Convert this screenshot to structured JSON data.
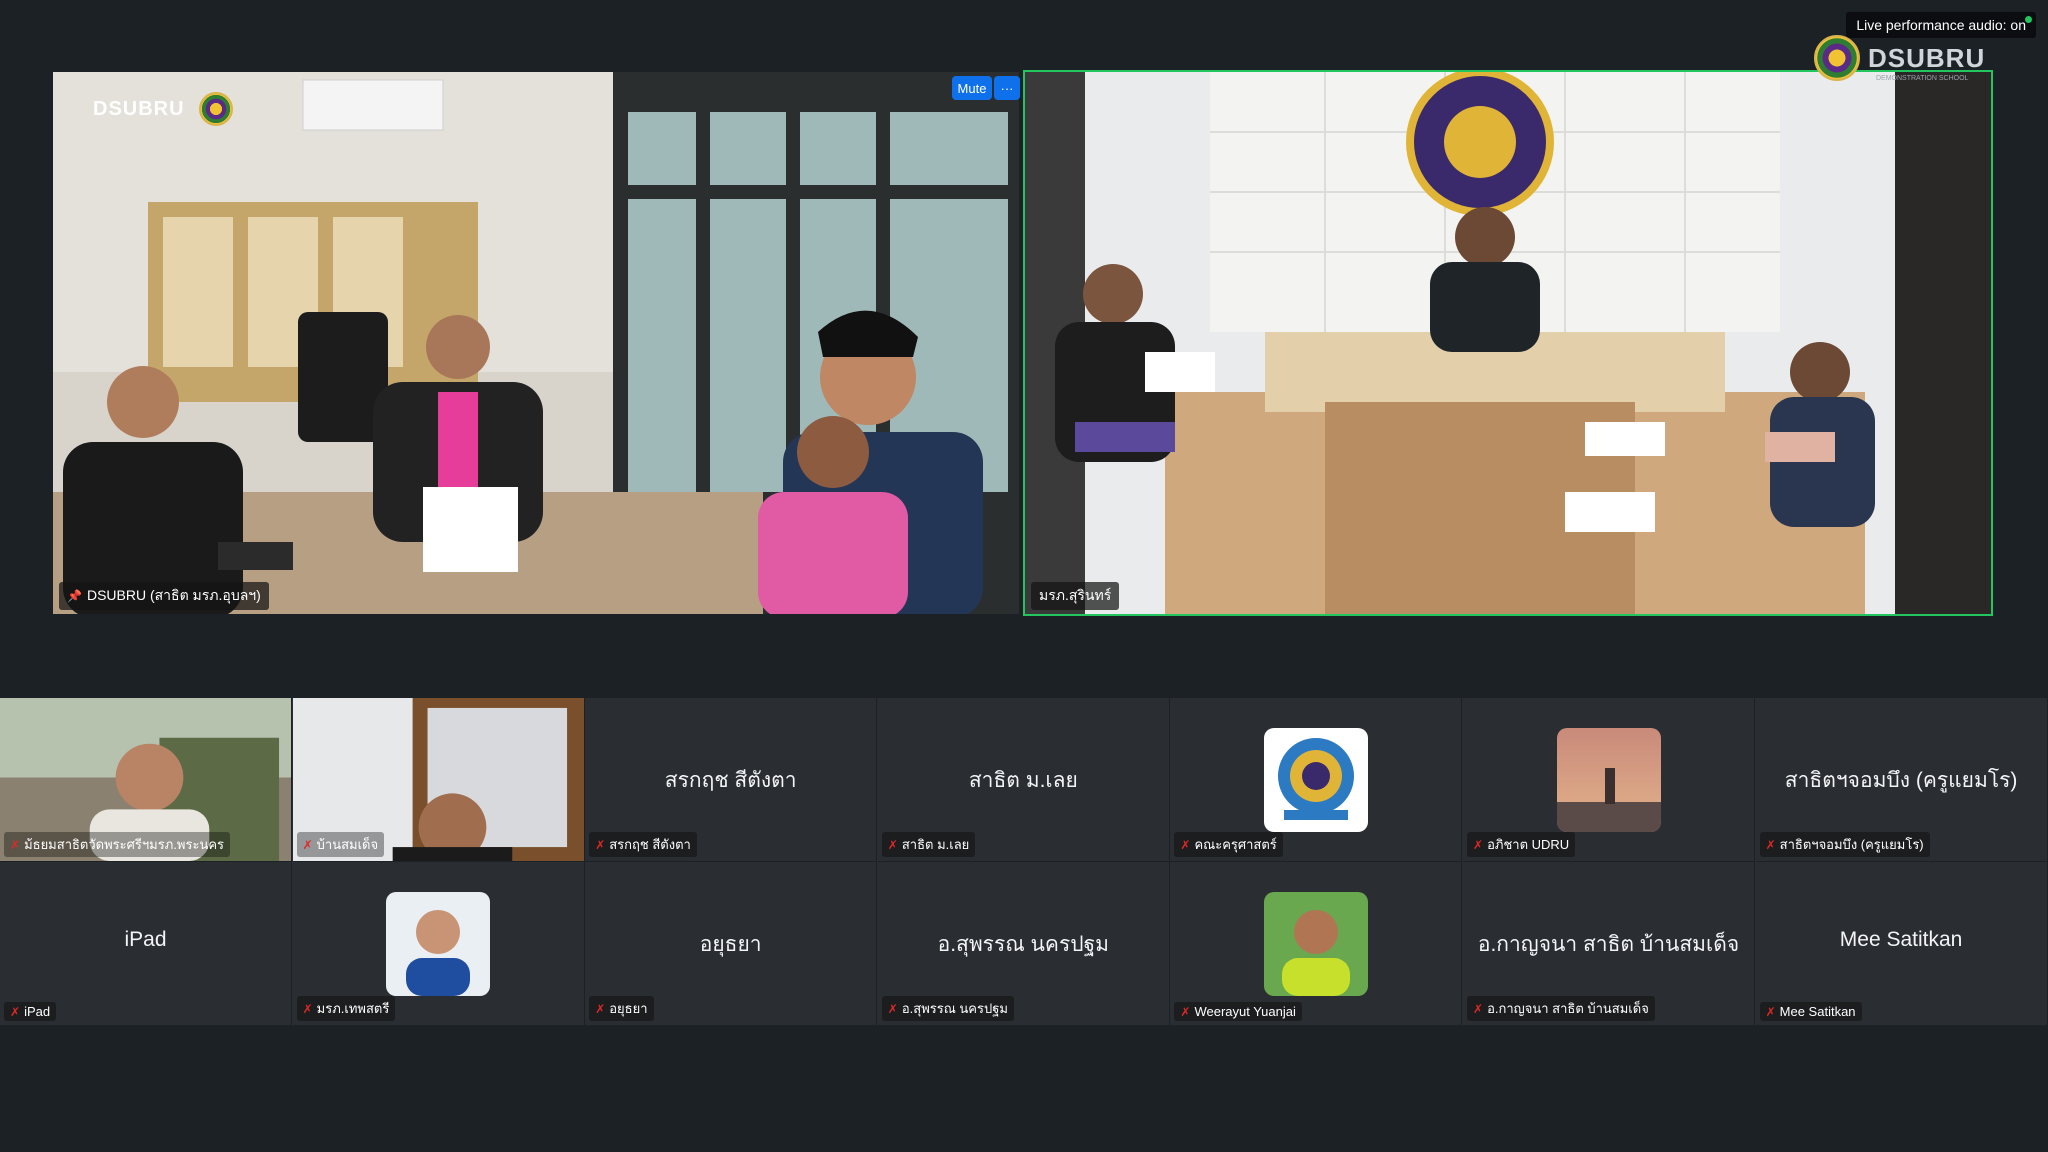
{
  "top_indicator": {
    "text": "Live performance audio: on"
  },
  "brand": {
    "name": "DSUBRU",
    "sub": "DEMONSTRATION SCHOOL"
  },
  "speaker_left": {
    "name": "DSUBRU (สาธิต มรภ.อุบลฯ)",
    "mute_label": "Mute",
    "more_label": "···"
  },
  "speaker_right": {
    "name": "มรภ.สุรินทร์"
  },
  "gallery": {
    "row1": [
      {
        "label": "ม้ธยมสาธิตวัดพระศรีฯมรภ.พระนคร",
        "center": "",
        "kind": "video-man"
      },
      {
        "label": "บ้านสมเด็จ",
        "center": "",
        "kind": "video-room"
      },
      {
        "label": "สรกฤช สีตังตา",
        "center": "สรกฤช สีตังตา",
        "kind": "text"
      },
      {
        "label": "สาธิต ม.เลย",
        "center": "สาธิต ม.เลย",
        "kind": "text"
      },
      {
        "label": "คณะครุศาสตร์",
        "center": "",
        "kind": "avatar-seal"
      },
      {
        "label": "อภิชาต UDRU",
        "center": "",
        "kind": "avatar-sunset"
      },
      {
        "label": "สาธิตฯจอมบึง (ครูแยมโร)",
        "center": "สาธิตฯจอมบึง (ครูแยมโร)",
        "kind": "text"
      }
    ],
    "row2": [
      {
        "label": "iPad",
        "center": "iPad",
        "kind": "text"
      },
      {
        "label": "มรภ.เทพสตรี",
        "center": "",
        "kind": "avatar-person"
      },
      {
        "label": "อยุธยา",
        "center": "อยุธยา",
        "kind": "text"
      },
      {
        "label": "อ.สุพรรณ นครปฐม",
        "center": "อ.สุพรรณ นครปฐม",
        "kind": "text"
      },
      {
        "label": "Weerayut Yuanjai",
        "center": "",
        "kind": "avatar-green"
      },
      {
        "label": "อ.กาญจนา สาธิต บ้านสมเด็จ",
        "center": "อ.กาญจนา สาธิต บ้านสมเด็จ",
        "kind": "text"
      },
      {
        "label": "Mee Satitkan",
        "center": "Mee Satitkan",
        "kind": "text"
      }
    ]
  }
}
